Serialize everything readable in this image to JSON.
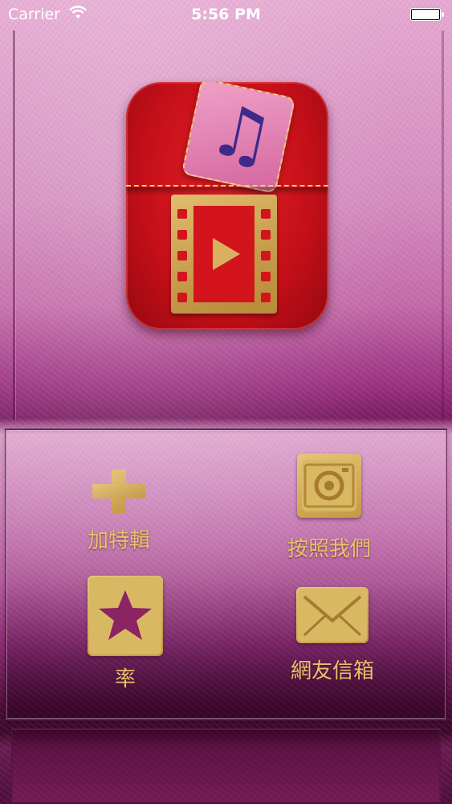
{
  "status_bar": {
    "carrier": "Carrier",
    "time": "5:56 PM",
    "wifi_icon": "wifi-icon",
    "battery_icon": "battery-icon"
  },
  "logo": {
    "icons": [
      "music-note-icon",
      "film-play-icon"
    ]
  },
  "menu": {
    "items": [
      {
        "label": "加特輯",
        "icon": "plus-icon"
      },
      {
        "label": "按照我們",
        "icon": "camera-icon"
      },
      {
        "label": "率",
        "icon": "star-icon"
      },
      {
        "label": "網友信箱",
        "icon": "mail-icon"
      }
    ]
  },
  "colors": {
    "gold": "#d9b864",
    "logo_red": "#c30f18",
    "background_pink": "#d58cc0"
  }
}
